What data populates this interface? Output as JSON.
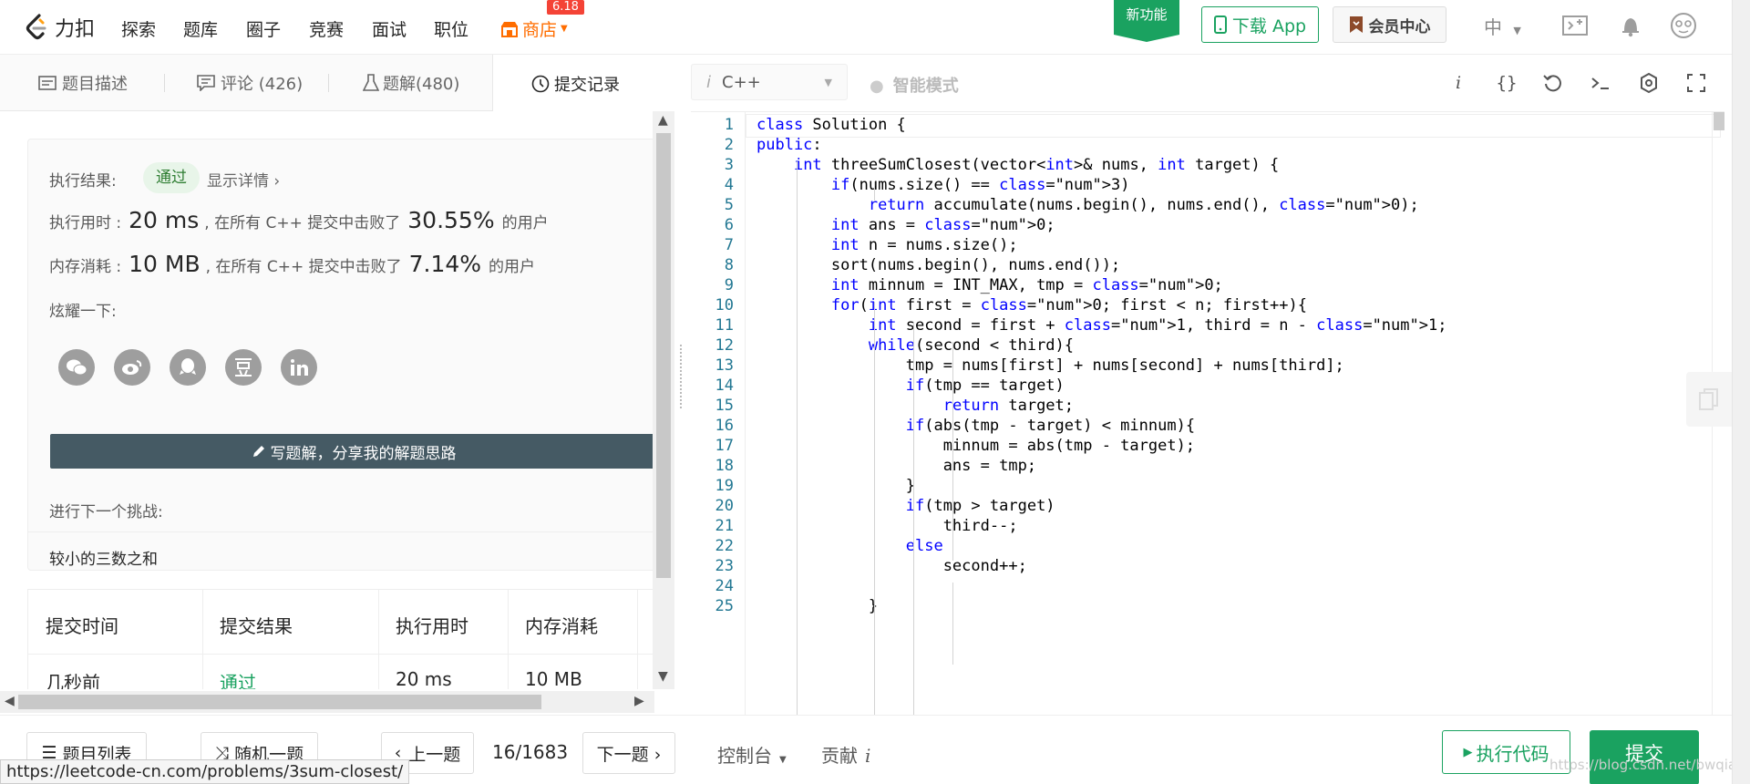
{
  "nav": {
    "brand": "力扣",
    "links": [
      "探索",
      "题库",
      "圈子",
      "竞赛",
      "面试",
      "职位"
    ],
    "store": "商店",
    "store_badge": "6.18",
    "new_feature": "新功能",
    "download_app": "下载 App",
    "vip_center": "会员中心",
    "language": "中"
  },
  "tabs": {
    "description": "题目描述",
    "comments": "评论 (426)",
    "solutions": "题解(480)",
    "submissions": "提交记录"
  },
  "result": {
    "exec_result_label": "执行结果:",
    "status": "通过",
    "show_details": "显示详情 ›",
    "runtime_label": "执行用时 :",
    "runtime_value": "20 ms",
    "runtime_mid": ", 在所有 C++ 提交中击败了",
    "runtime_percent": "30.55%",
    "users_suffix": "的用户",
    "memory_label": "内存消耗 :",
    "memory_value": "10 MB",
    "memory_mid": ", 在所有 C++ 提交中击败了",
    "memory_percent": "7.14%",
    "share_label": "炫耀一下:",
    "write_solution": "写题解，分享我的解题思路",
    "next_challenge_label": "进行下一个挑战:",
    "next_problem": "较小的三数之和"
  },
  "submission_table": {
    "headers": [
      "提交时间",
      "提交结果",
      "执行用时",
      "内存消耗"
    ],
    "rows": [
      [
        "几秒前",
        "通过",
        "20 ms",
        "10 MB"
      ]
    ]
  },
  "editor": {
    "language": "C++",
    "smart_mode": "智能模式",
    "info_icon": "i",
    "lines": [
      "class Solution {",
      "public:",
      "    int threeSumClosest(vector<int>& nums, int target) {",
      "        if(nums.size() == 3)",
      "            return accumulate(nums.begin(), nums.end(), 0);",
      "        int ans = 0;",
      "        int n = nums.size();",
      "        sort(nums.begin(), nums.end());",
      "        int minnum = INT_MAX, tmp = 0;",
      "        for(int first = 0; first < n; first++){",
      "            int second = first + 1, third = n - 1;",
      "            while(second < third){",
      "                tmp = nums[first] + nums[second] + nums[third];",
      "                if(tmp == target)",
      "                    return target;",
      "                if(abs(tmp - target) < minnum){",
      "                    minnum = abs(tmp - target);",
      "                    ans = tmp;",
      "                }",
      "                if(tmp > target)",
      "                    third--;",
      "                else",
      "                    second++;",
      "",
      "            }"
    ]
  },
  "bottom": {
    "problem_list": "题目列表",
    "random": "随机一题",
    "prev": "上一题",
    "pager": "16/1683",
    "next": "下一题 ›",
    "console": "控制台",
    "contribute": "贡献",
    "run_code": "执行代码",
    "submit": "提交"
  },
  "status_url": "https://leetcode-cn.com/problems/3sum-closest/",
  "watermark": "https://blog.csdn.net/bwqiang",
  "colors": {
    "brand_green": "#1aa260",
    "store_orange": "#ff6d00",
    "badge_red": "#f44336",
    "keyword_blue": "#0000ff",
    "number_green": "#098658"
  }
}
